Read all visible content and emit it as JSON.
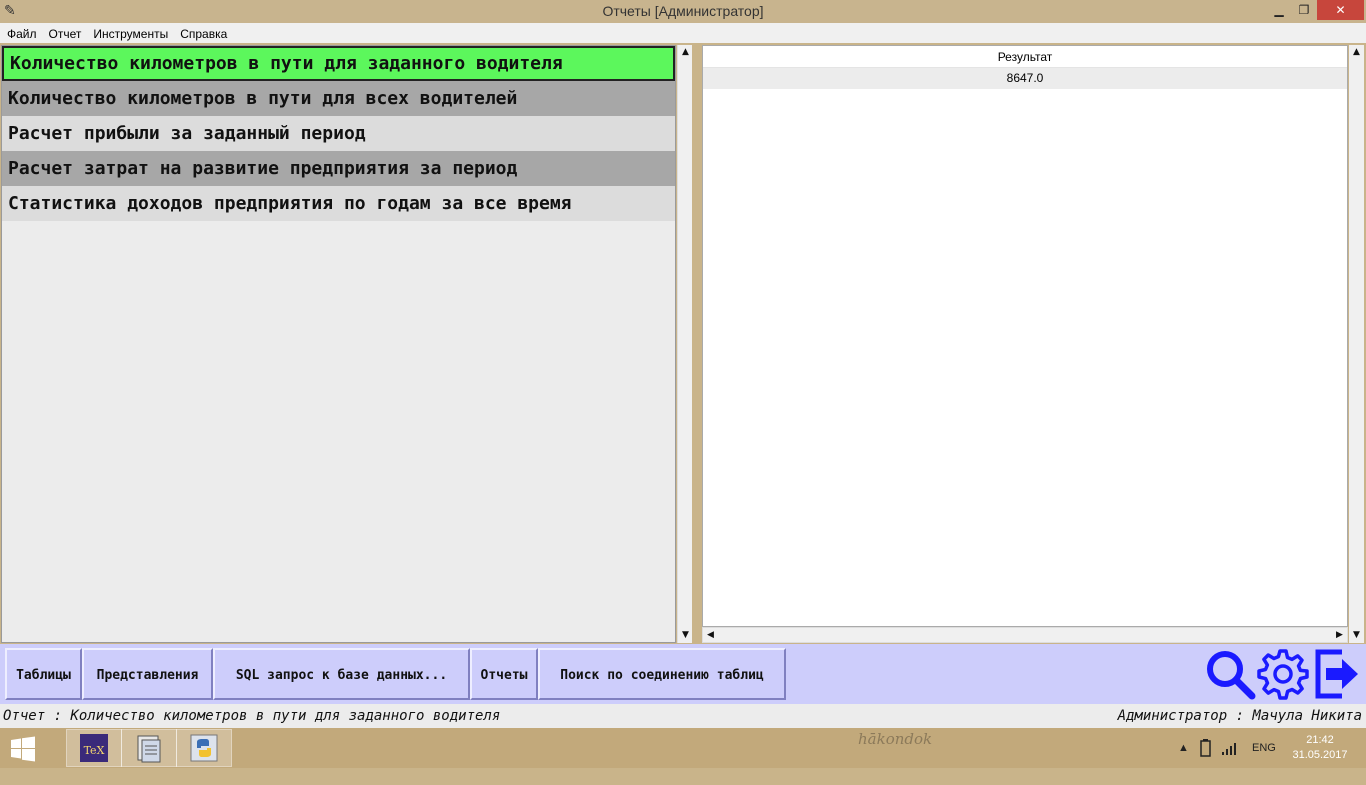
{
  "window": {
    "title": "Отчеты [Администратор]"
  },
  "menu": {
    "items": [
      "Файл",
      "Отчет",
      "Инструменты",
      "Справка"
    ]
  },
  "reports": {
    "items": [
      "Количество километров в пути для заданного водителя",
      "Количество километров в пути для всех водителей",
      "Расчет прибыли за заданный период",
      "Расчет затрат на развитие предприятия за период",
      "Статистика доходов предприятия по годам за все время"
    ],
    "selected_index": 0
  },
  "result": {
    "column_header": "Результат",
    "rows": [
      "8647.0"
    ]
  },
  "toolbar": {
    "buttons": [
      "Таблицы",
      "Представления",
      "SQL запрос к базе данных...",
      "Отчеты",
      "Поиск по соединению таблиц"
    ],
    "icons": [
      "search-icon",
      "settings-gear-icon",
      "exit-icon"
    ],
    "icon_color": "#1a1aff"
  },
  "status": {
    "left": "Отчет : Количество километров в пути для заданного водителя",
    "right": "Администратор : Мачула Никита"
  },
  "taskbar": {
    "apps": [
      "texmaker-icon",
      "file-manager-icon",
      "python-icon"
    ],
    "tray": {
      "language": "ENG",
      "time": "21:42",
      "date": "31.05.2017"
    }
  },
  "colors": {
    "selected_item": "#5cf75c",
    "toolbar_bg": "#cdcdfb",
    "close_button": "#c7463c"
  }
}
